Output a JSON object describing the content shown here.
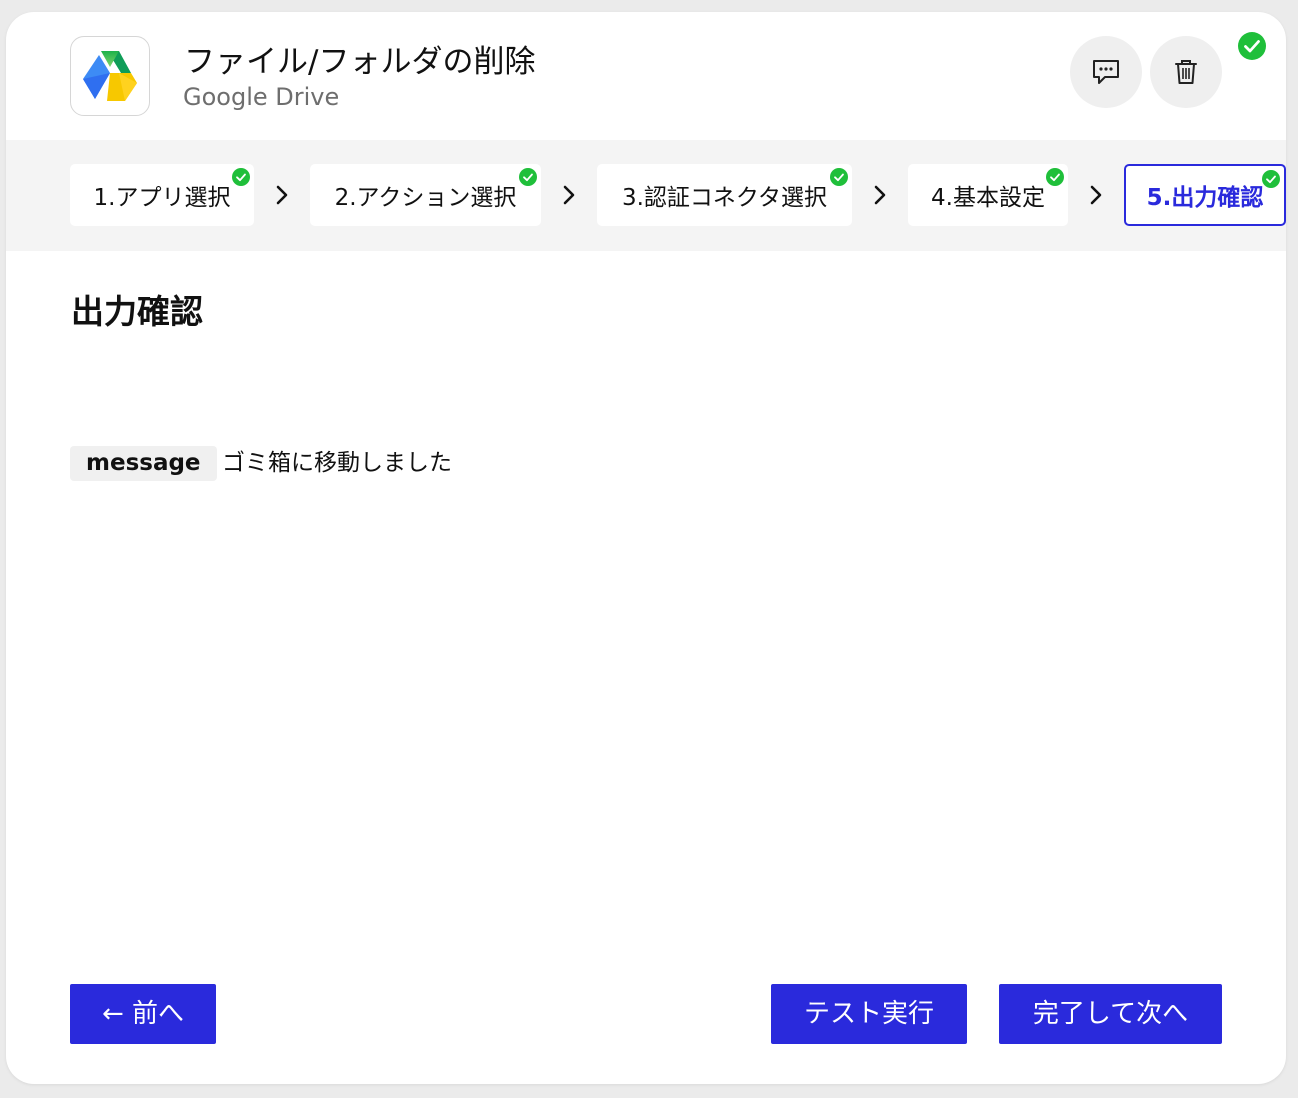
{
  "header": {
    "title": "ファイル/フォルダの削除",
    "app_name": "Google Drive",
    "logo_icon": "google-drive-logo",
    "comment_icon": "comment-icon",
    "trash_icon": "trash-icon",
    "status": "complete"
  },
  "steps": [
    {
      "label": "1.アプリ選択",
      "done": true
    },
    {
      "label": "2.アクション選択",
      "done": true
    },
    {
      "label": "3.認証コネクタ選択",
      "done": true
    },
    {
      "label": "4.基本設定",
      "done": true
    },
    {
      "label": "5.出力確認",
      "done": true,
      "active": true
    }
  ],
  "main": {
    "section_title": "出力確認",
    "output": {
      "key": "message",
      "value": "ゴミ箱に移動しました"
    }
  },
  "footer": {
    "prev_label": "← 前へ",
    "test_label": "テスト実行",
    "next_label": "完了して次へ"
  },
  "colors": {
    "accent": "#2a2adc",
    "success": "#1fbf3a",
    "card_bg": "#ffffff",
    "stepper_bg": "#f4f4f4"
  }
}
